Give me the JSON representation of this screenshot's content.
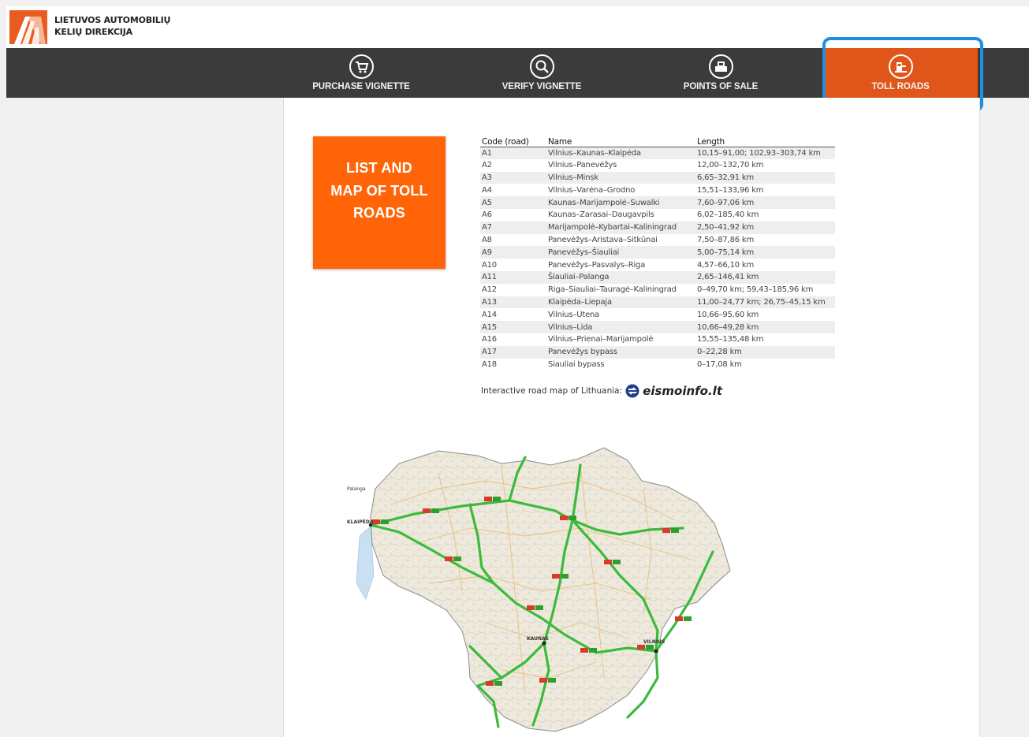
{
  "brand": {
    "line1": "LIETUVOS AUTOMOBILIŲ",
    "line2": "KELIŲ DIREKCIJA",
    "logo_icon": "road-logo-icon"
  },
  "nav": {
    "items": [
      {
        "label": "PURCHASE VIGNETTE",
        "icon": "cart-icon"
      },
      {
        "label": "VERIFY VIGNETTE",
        "icon": "magnifier-icon"
      },
      {
        "label": "POINTS OF SALE",
        "icon": "store-icon"
      },
      {
        "label": "TOLL ROADS",
        "icon": "toll-road-icon",
        "active": true
      }
    ]
  },
  "tile": {
    "line1": "LIST AND",
    "line2": "MAP OF TOLL",
    "line3": "ROADS"
  },
  "table": {
    "headers": [
      "Code (road)",
      "Name",
      "Length"
    ],
    "rows": [
      [
        "A1",
        "Vilnius–Kaunas–Klaipėda",
        "10,15–91,00; 102,93–303,74 km"
      ],
      [
        "A2",
        "Vilnius–Panevėžys",
        "12,00–132,70 km"
      ],
      [
        "A3",
        "Vilnius–Minsk",
        "6,65–32,91 km"
      ],
      [
        "A4",
        "Vilnius–Varėna–Grodno",
        "15,51–133,96 km"
      ],
      [
        "A5",
        "Kaunas–Marijampolė–Suwalki",
        "7,60–97,06 km"
      ],
      [
        "A6",
        "Kaunas–Zarasai–Daugavpils",
        "6,02–185,40 km"
      ],
      [
        "A7",
        "Marijampolė–Kybartai–Kaliningrad",
        "2,50–41,92 km"
      ],
      [
        "A8",
        "Panevėžys–Aristava–Sitkūnai",
        "7,50–87,86 km"
      ],
      [
        "A9",
        "Panevėžys–Šiauliai",
        "5,00–75,14 km"
      ],
      [
        "A10",
        "Panevėžys–Pasvalys–Riga",
        "4,57–66,10 km"
      ],
      [
        "A11",
        "Šiauliai–Palanga",
        "2,65–146,41 km"
      ],
      [
        "A12",
        "Riga–Siauliai–Tauragė–Kaliningrad",
        "0–49,70 km; 59,43–185,96 km"
      ],
      [
        "A13",
        "Klaipėda–Liepaja",
        "11,00–24,77 km; 26,75–45,15 km"
      ],
      [
        "A14",
        "Vilnius–Utena",
        "10,66–95,60 km"
      ],
      [
        "A15",
        "Vilnius–Lida",
        "10,66–49,28 km"
      ],
      [
        "A16",
        "Vilnius–Prienai–Marijampolė",
        "15,55–135,48 km"
      ],
      [
        "A17",
        "Panevėžys bypass",
        "0–22,28 km"
      ],
      [
        "A18",
        "Siauliai bypass",
        "0–17,08 km"
      ]
    ]
  },
  "interactive": {
    "label": "Interactive road map of Lithuania:",
    "link": "eismoinfo.lt",
    "link_icon": "eismoinfo-logo-icon"
  },
  "map": {
    "icon": "lithuania-road-map-icon",
    "cities": [
      "KLAIPĖDA",
      "VILNIUS",
      "KAUNAS",
      "Palanga"
    ]
  },
  "colors": {
    "accent": "#e0561a",
    "tile": "#ff6508",
    "navbar": "#3b3b3b",
    "highlight": "#1d8fe3",
    "road": "#3cba3c"
  }
}
